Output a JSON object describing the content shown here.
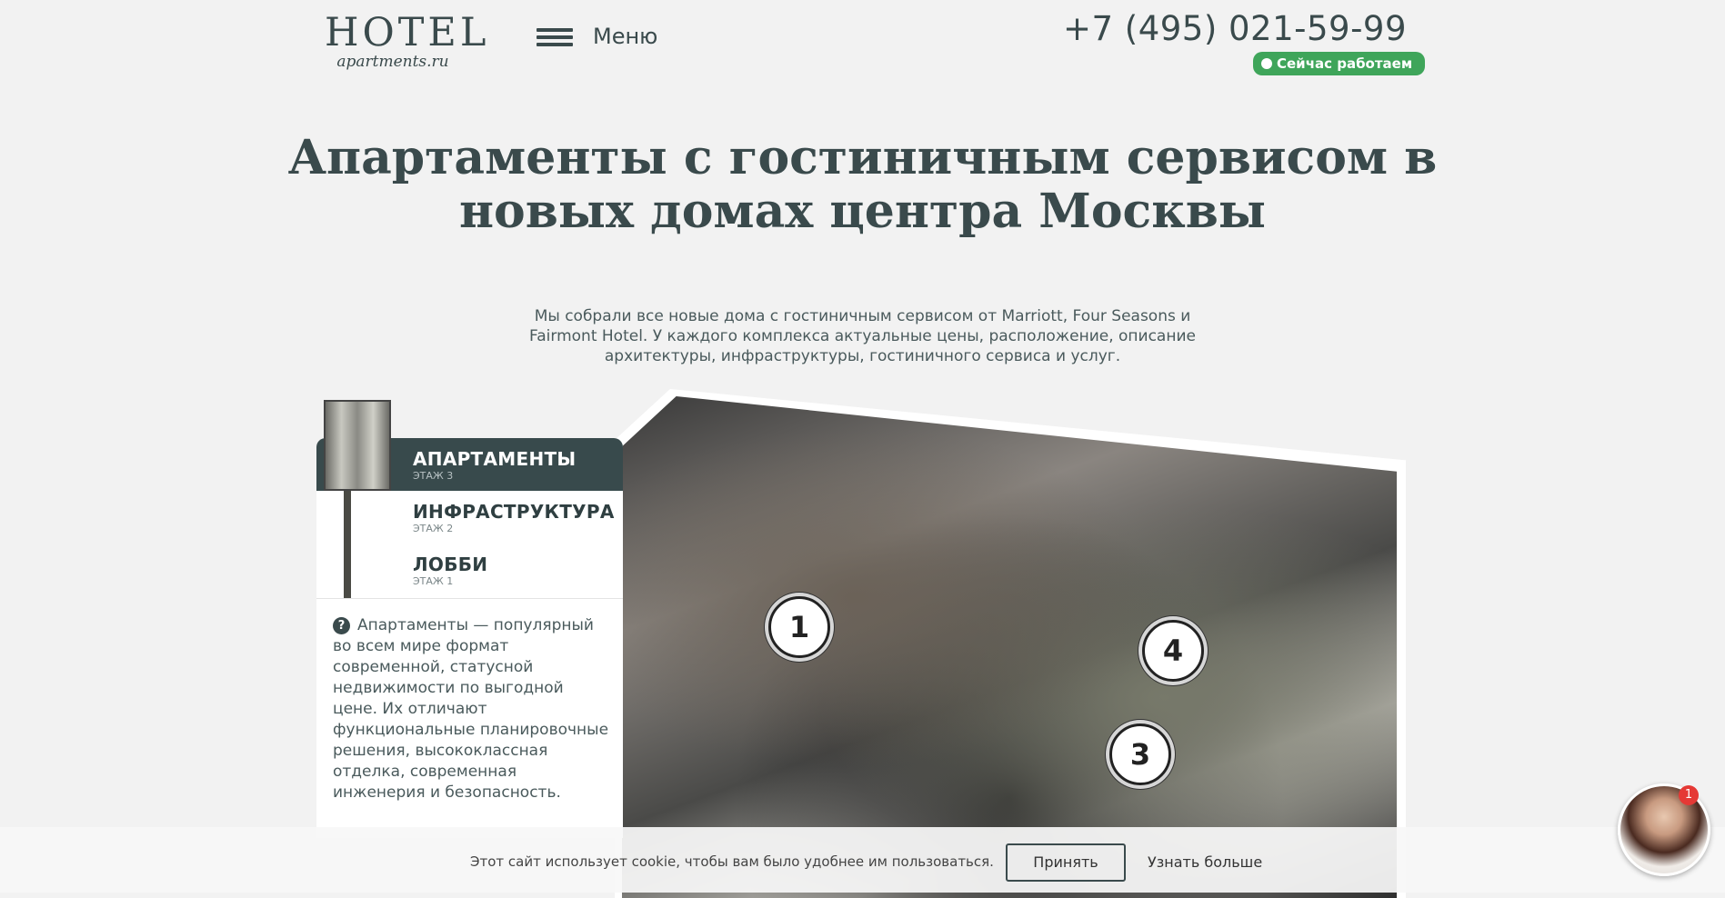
{
  "header": {
    "logo_main": "HOTEL",
    "logo_sub": "apartments.ru",
    "menu_label": "Меню",
    "phone": "+7 (495) 021-59-99",
    "status": "Сейчас работаем"
  },
  "hero": {
    "title": "Апартаменты с гостиничным сервисом в новых домах центра Москвы",
    "subtitle": "Мы собрали все новые дома с гостиничным сервисом от Marriott, Four Seasons и Fairmont Hotel. У каждого комплекса актуальные цены, расположение, описание архитектуры, инфраструктуры, гостиничного сервиса и услуг."
  },
  "floors": [
    {
      "title": "АПАРТАМЕНТЫ",
      "sub": "ЭТАЖ 3"
    },
    {
      "title": "ИНФРАСТРУКТУРА",
      "sub": "ЭТАЖ 2"
    },
    {
      "title": "ЛОББИ",
      "sub": "ЭТАЖ 1"
    }
  ],
  "help_text": "Апартаменты — популярный во всем мире формат современной, статусной недвижимости по выгодной цене. Их отличают функциональные планировочные решения, высококлассная отделка, современная инженерия и безопасность.",
  "markers": [
    "1",
    "4",
    "3"
  ],
  "cookie": {
    "text": "Этот сайт использует cookie, чтобы вам было удобнее им пользоваться.",
    "accept": "Принять",
    "more": "Узнать больше"
  },
  "chat": {
    "badge": "1"
  }
}
